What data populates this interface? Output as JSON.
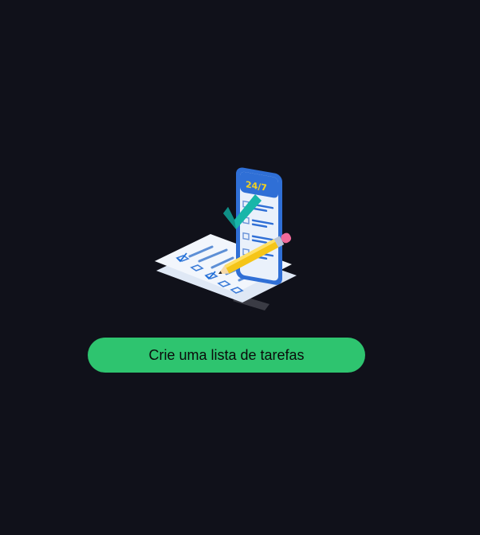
{
  "empty_state": {
    "illustration_icon": "checklist-phone-illustration",
    "illustration_badge": "24/7",
    "cta_label": "Crie uma lista de tarefas"
  },
  "colors": {
    "background": "#10111a",
    "accent": "#2ec46f",
    "phone_blue": "#2f6fd6",
    "check_teal": "#17b6a9",
    "pencil_yellow": "#f5c518",
    "pencil_pink": "#f06a9a"
  }
}
